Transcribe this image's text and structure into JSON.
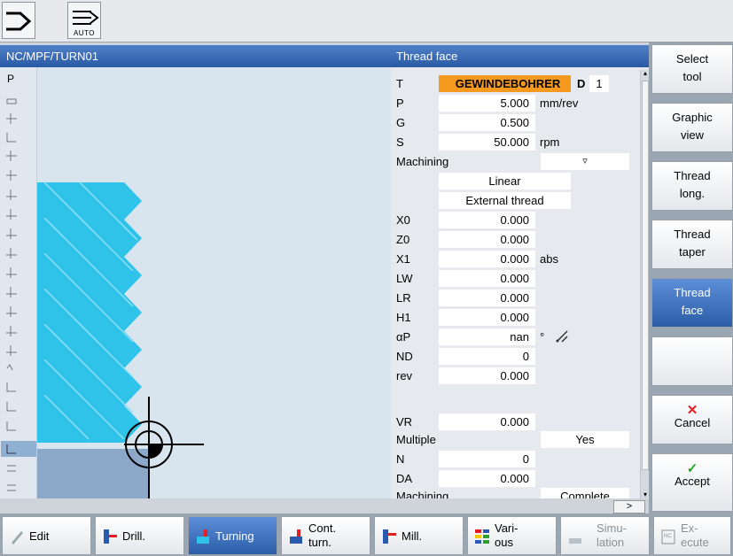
{
  "top_indicator": {
    "mode_label": "AUTO"
  },
  "program_path": "NC/MPF/TURN01",
  "form": {
    "title": "Thread face",
    "tool": {
      "label": "T",
      "value": "GEWINDEBOHRER",
      "d_label": "D",
      "d_value": "1"
    },
    "rows": [
      {
        "label": "P",
        "value": "5.000",
        "unit": "mm/rev"
      },
      {
        "label": "G",
        "value": "0.500",
        "unit": ""
      },
      {
        "label": "S",
        "value": "50.000",
        "unit": "rpm"
      }
    ],
    "machining": {
      "label": "Machining",
      "dropdown_symbol": "▿"
    },
    "options": [
      "Linear",
      "External thread"
    ],
    "rows2": [
      {
        "label": "X0",
        "value": "0.000",
        "unit": ""
      },
      {
        "label": "Z0",
        "value": "0.000",
        "unit": ""
      },
      {
        "label": "X1",
        "value": "0.000",
        "unit": "abs"
      },
      {
        "label": "LW",
        "value": "0.000",
        "unit": ""
      },
      {
        "label": "LR",
        "value": "0.000",
        "unit": ""
      },
      {
        "label": "H1",
        "value": "0.000",
        "unit": ""
      },
      {
        "label": "αP",
        "value": "nan",
        "unit": "°"
      },
      {
        "label": "ND",
        "value": "0",
        "unit": ""
      },
      {
        "label": "rev",
        "value": "0.000",
        "unit": ""
      }
    ],
    "vr": {
      "label": "VR",
      "value": "0.000"
    },
    "multiple": {
      "label": "Multiple",
      "value": "Yes"
    },
    "rows3": [
      {
        "label": "N",
        "value": "0"
      },
      {
        "label": "DA",
        "value": "0.000"
      }
    ],
    "cut_label": "Machining",
    "cut_value": "Complete"
  },
  "scroll_more": ">",
  "vertical_softkeys": [
    {
      "line1": "Select",
      "line2": "tool"
    },
    {
      "line1": "Graphic",
      "line2": "view"
    },
    {
      "line1": "Thread",
      "line2": "long."
    },
    {
      "line1": "Thread",
      "line2": "taper"
    },
    {
      "line1": "Thread",
      "line2": "face"
    },
    {
      "line1": "",
      "line2": ""
    },
    {
      "line1": "Cancel",
      "line2": ""
    },
    {
      "line1": "Accept",
      "line2": ""
    }
  ],
  "horizontal_softkeys": [
    {
      "line1": "Edit",
      "line2": ""
    },
    {
      "line1": "Drill.",
      "line2": ""
    },
    {
      "line1": "Turning",
      "line2": ""
    },
    {
      "line1": "Cont.",
      "line2": "turn."
    },
    {
      "line1": "Mill.",
      "line2": ""
    },
    {
      "line1": "Vari-",
      "line2": "ous"
    },
    {
      "line1": "Simu-",
      "line2": "lation"
    },
    {
      "line1": "Ex-",
      "line2": "ecute"
    }
  ],
  "left_icon_bar": {
    "first_label": "P"
  },
  "colors": {
    "title_bar": "#2a5aa5",
    "active_softkey": "#3a6cbf",
    "tool_highlight": "#f59a1e",
    "thread_fill": "#2fc3ea"
  }
}
